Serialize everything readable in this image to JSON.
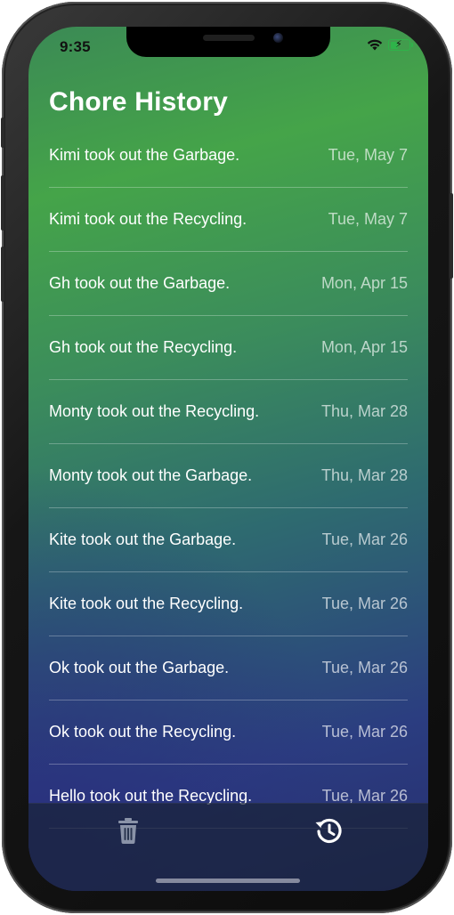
{
  "status_bar": {
    "time": "9:35"
  },
  "header": {
    "title": "Chore History"
  },
  "history": [
    {
      "text": "Kimi took out the Garbage.",
      "date": "Tue, May 7"
    },
    {
      "text": "Kimi took out the Recycling.",
      "date": "Tue, May 7"
    },
    {
      "text": "Gh took out the Garbage.",
      "date": "Mon, Apr 15"
    },
    {
      "text": "Gh took out the Recycling.",
      "date": "Mon, Apr 15"
    },
    {
      "text": "Monty took out the Recycling.",
      "date": "Thu, Mar 28"
    },
    {
      "text": "Monty took out the Garbage.",
      "date": "Thu, Mar 28"
    },
    {
      "text": "Kite took out the Garbage.",
      "date": "Tue, Mar 26"
    },
    {
      "text": "Kite took out the Recycling.",
      "date": "Tue, Mar 26"
    },
    {
      "text": "Ok took out the Garbage.",
      "date": "Tue, Mar 26"
    },
    {
      "text": "Ok took out the Recycling.",
      "date": "Tue, Mar 26"
    },
    {
      "text": "Hello took out the Recycling.",
      "date": "Tue, Mar 26"
    }
  ],
  "tab_bar": {
    "tabs": [
      {
        "icon": "trash-icon",
        "active": false
      },
      {
        "icon": "history-icon",
        "active": true
      }
    ]
  },
  "colors": {
    "gradient_top": "#45a449",
    "gradient_bottom": "#262d6e",
    "battery": "#2fb34a"
  }
}
